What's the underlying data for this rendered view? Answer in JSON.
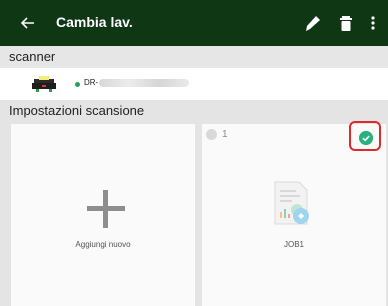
{
  "appbar": {
    "title": "Cambia lav.",
    "back_icon": "arrow-left-icon",
    "actions": [
      "pencil-icon",
      "trash-icon",
      "more-vert-icon"
    ],
    "background_color": "#0f3713"
  },
  "scanner_section": {
    "header": "scanner",
    "device_name": "DR-",
    "status_color": "#1fa45a"
  },
  "settings_section": {
    "header": "Impostazioni scansione",
    "cards": [
      {
        "label": "Aggiungi nuovo",
        "icon": "plus-icon"
      },
      {
        "label": "JOB1",
        "number": "1",
        "icon": "document-chart-icon",
        "selected": true,
        "check_color": "#29b27d"
      }
    ]
  }
}
